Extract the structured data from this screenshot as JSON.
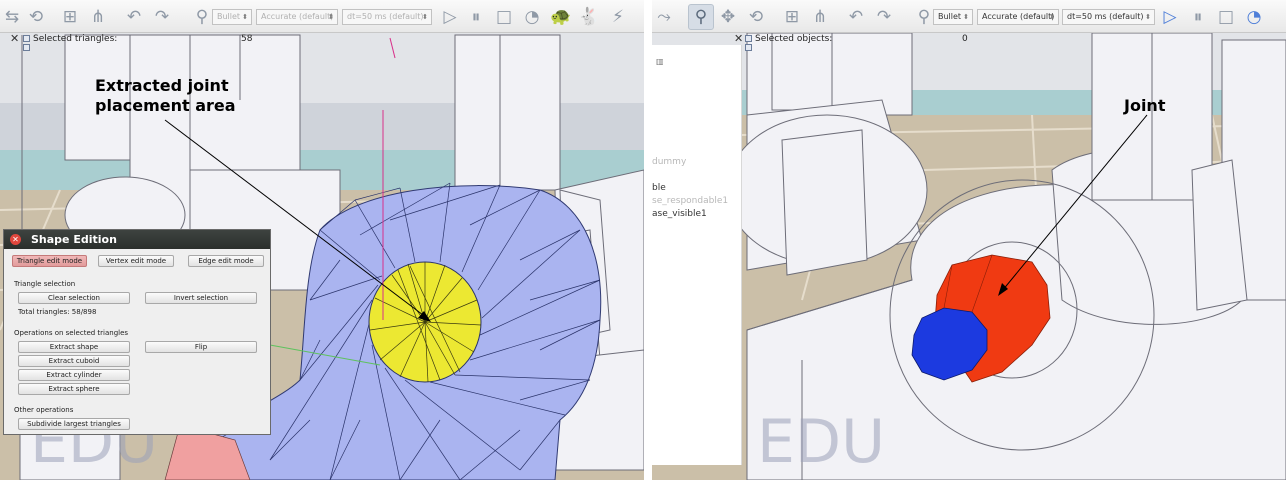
{
  "left_view": {
    "toolbar": {
      "engine": "Bullet",
      "accuracy": "Accurate (default)",
      "timestep": "dt=50 ms (default)"
    },
    "info": {
      "label": "Selected triangles:",
      "value": "58"
    },
    "annotation": {
      "line1": "Extracted joint",
      "line2": "placement area"
    },
    "watermark": "EDU",
    "colors": {
      "mesh": "#aab4f0",
      "selected_face": "#ece832",
      "background_floor": "#cbbfa8"
    }
  },
  "shape_edition": {
    "title": "Shape Edition",
    "modes": [
      "Triangle edit mode",
      "Vertex edit mode",
      "Edge edit mode"
    ],
    "triangle_selection_heading": "Triangle selection",
    "clear_selection": "Clear selection",
    "invert_selection": "Invert selection",
    "total_triangles": "Total triangles: 58/898",
    "operations_heading": "Operations on selected triangles",
    "extract_shape": "Extract shape",
    "flip": "Flip",
    "extract_cuboid": "Extract cuboid",
    "extract_cylinder": "Extract cylinder",
    "extract_sphere": "Extract sphere",
    "other_heading": "Other operations",
    "subdivide": "Subdivide largest triangles"
  },
  "right_view": {
    "toolbar": {
      "engine": "Bullet",
      "accuracy": "Accurate (default)",
      "timestep": "dt=50 ms (default)"
    },
    "info": {
      "label": "Selected objects:",
      "value": "0"
    },
    "annotation": "Joint",
    "watermark": "EDU",
    "scene_tree": [
      "dummy",
      "ble",
      "se_respondable1",
      "ase_visible1"
    ],
    "colors": {
      "joint_red": "#f03a12",
      "joint_blue": "#1c3ae0"
    }
  }
}
